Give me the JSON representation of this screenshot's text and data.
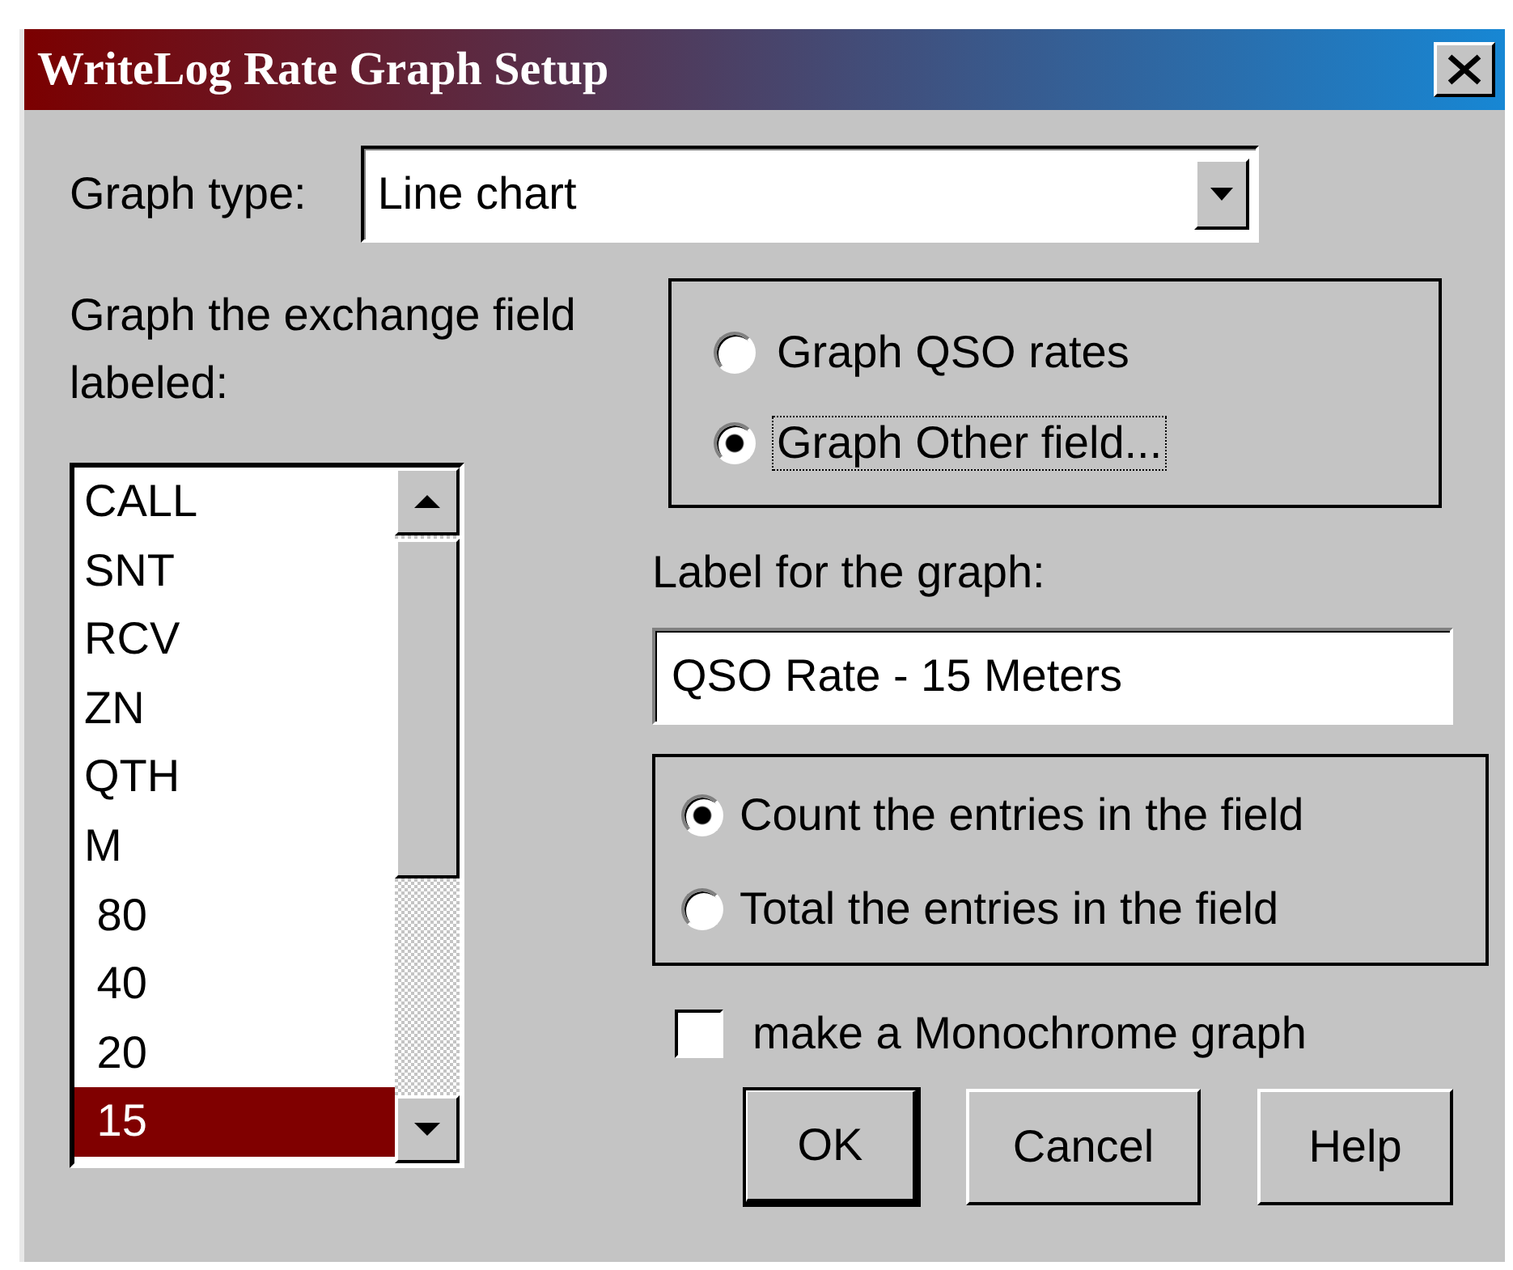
{
  "window": {
    "title": "WriteLog Rate Graph Setup"
  },
  "graph_type": {
    "label": "Graph type:",
    "value": "Line chart"
  },
  "field_list": {
    "label": "Graph the exchange field labeled:",
    "items": [
      {
        "text": "CALL",
        "selected": false
      },
      {
        "text": "SNT",
        "selected": false
      },
      {
        "text": "RCV",
        "selected": false
      },
      {
        "text": "ZN",
        "selected": false
      },
      {
        "text": "QTH",
        "selected": false
      },
      {
        "text": "M",
        "selected": false
      },
      {
        "text": " 80",
        "selected": false
      },
      {
        "text": " 40",
        "selected": false
      },
      {
        "text": " 20",
        "selected": false
      },
      {
        "text": " 15",
        "selected": true
      }
    ]
  },
  "source_options": [
    {
      "label": "Graph QSO rates",
      "selected": false,
      "focused": false
    },
    {
      "label": "Graph Other field...",
      "selected": true,
      "focused": true
    }
  ],
  "graph_label": {
    "label": "Label for the graph:",
    "value": "QSO Rate - 15 Meters"
  },
  "count_options": [
    {
      "label": "Count the entries in the field",
      "selected": true
    },
    {
      "label": "Total the entries in the field",
      "selected": false
    }
  ],
  "monochrome": {
    "label": "make a Monochrome graph",
    "checked": false
  },
  "buttons": [
    {
      "label": "OK",
      "default": true
    },
    {
      "label": "Cancel",
      "default": false
    },
    {
      "label": "Help",
      "default": false
    }
  ]
}
